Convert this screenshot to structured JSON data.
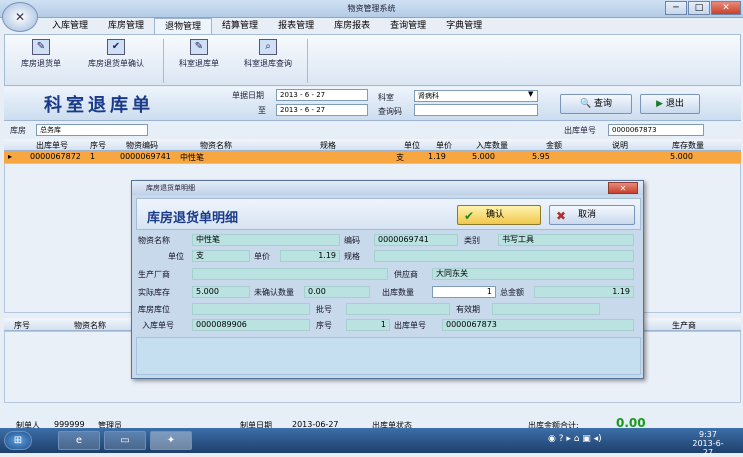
{
  "window": {
    "title": "物资管理系统",
    "min": "─",
    "max": "□",
    "close": "✕"
  },
  "menu": [
    "入库管理",
    "库房管理",
    "退物管理",
    "结算管理",
    "报表管理",
    "库房报表",
    "查询管理",
    "字典管理"
  ],
  "ribbon": [
    {
      "label": "库房退货单",
      "icon": "edit-doc-icon"
    },
    {
      "label": "库房退货单确认",
      "icon": "folder-check-icon"
    },
    {
      "label": "科室退库单",
      "icon": "edit-doc-icon"
    },
    {
      "label": "科室退库查询",
      "icon": "folder-search-icon"
    }
  ],
  "header": {
    "title": "科室退库单",
    "date_label": "单据日期",
    "date_from": "2013 - 6 - 27",
    "to_label": "至",
    "date_to": "2013 - 6 - 27",
    "dept_label": "科室",
    "dept_value": "肾病科",
    "query_code_label": "查询码",
    "query_button": "查询",
    "exit_button": "退出"
  },
  "filter": {
    "warehouse_label": "库房",
    "warehouse_value": "总务库",
    "out_no_label": "出库单号",
    "out_no_value": "0000067873"
  },
  "grid": {
    "columns": [
      "出库单号",
      "序号",
      "物资编码",
      "物资名称",
      "规格",
      "单位",
      "单价",
      "入库数量",
      "金额",
      "说明",
      "库存数量"
    ],
    "row": {
      "out_no": "0000067872",
      "seq": "1",
      "code": "0000069741",
      "name": "中性笔",
      "unit": "支",
      "price": "1.19",
      "qty": "5.000",
      "amount": "5.95",
      "stock": "5.000"
    }
  },
  "grid2": {
    "columns": [
      "序号",
      "物资名称",
      "生产商"
    ]
  },
  "footer": {
    "maker_label": "制单人",
    "maker_value": "999999",
    "maker_name": "管理员",
    "date_label": "制单日期",
    "date_value": "2013-06-27",
    "status_label": "出库单状态",
    "total_label": "出库金额合计:",
    "total_value": "0.00"
  },
  "dialog": {
    "title": "库房退货单明细",
    "heading": "库房退货单明细",
    "confirm": "确认",
    "cancel": "取消",
    "fields": {
      "name_label": "物资名称",
      "name": "中性笔",
      "code_label": "编码",
      "code": "0000069741",
      "category_label": "类别",
      "category": "书写工具",
      "unit_label": "单位",
      "unit": "支",
      "price_label": "单价",
      "price": "1.19",
      "spec_label": "规格",
      "maker_label": "生产厂商",
      "supplier_label": "供应商",
      "supplier": "大同东关",
      "stock_label": "实际库存",
      "stock": "5.000",
      "unconfirmed_label": "未确认数量",
      "unconfirmed": "0.00",
      "out_qty_label": "出库数量",
      "out_qty": "1",
      "total_label": "总金额",
      "total": "1.19",
      "location_label": "库房库位",
      "batch_label": "批号",
      "expiry_label": "有效期",
      "in_no_label": "入库单号",
      "in_no": "0000089906",
      "seq_label": "序号",
      "seq": "1",
      "out_no_label": "出库单号",
      "out_no": "0000067873"
    }
  },
  "taskbar": {
    "time": "9:37",
    "date": "2013-6-27"
  },
  "colors": {
    "accent": "#1a3a8a",
    "selected_row": "#f8a640",
    "field": "#b9e2e0",
    "total": "#1a9a1a"
  }
}
